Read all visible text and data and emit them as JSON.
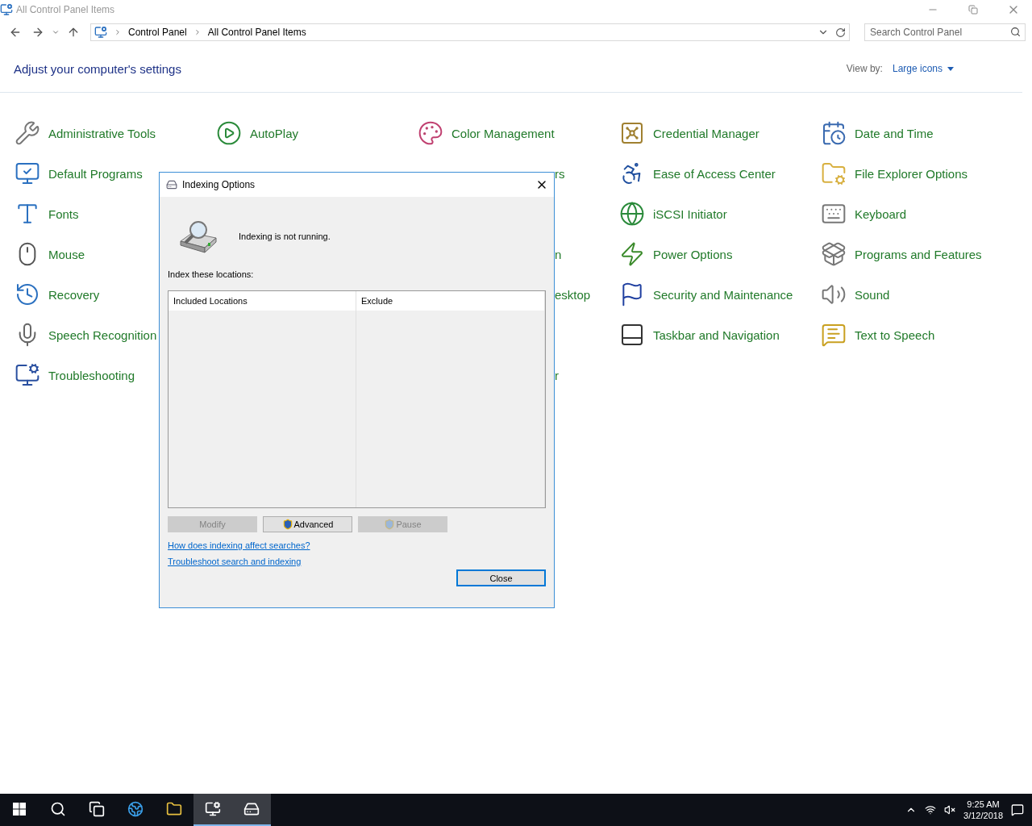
{
  "window": {
    "title": "All Control Panel Items"
  },
  "address_bar": {
    "breadcrumbs": [
      "Control Panel",
      "All Control Panel Items"
    ]
  },
  "search": {
    "placeholder": "Search Control Panel"
  },
  "heading": "Adjust your computer's settings",
  "view_by": {
    "label": "View by:",
    "value": "Large icons"
  },
  "rows": [
    [
      {
        "kind": "item",
        "label": "Administrative Tools"
      },
      {
        "kind": "item",
        "label": "AutoPlay"
      },
      {
        "kind": "item",
        "label": "Color Management"
      },
      {
        "kind": "item",
        "label": "Credential Manager"
      },
      {
        "kind": "item",
        "label": "Date and Time"
      }
    ],
    [
      {
        "kind": "item",
        "label": "Default Programs"
      },
      {
        "kind": "covered"
      },
      {
        "kind": "fragment",
        "label": "rs"
      },
      {
        "kind": "item",
        "label": "Ease of Access Center"
      },
      {
        "kind": "item",
        "label": "File Explorer Options"
      }
    ],
    [
      {
        "kind": "item",
        "label": "Fonts"
      },
      {
        "kind": "covered"
      },
      {
        "kind": "covered"
      },
      {
        "kind": "item",
        "label": "iSCSI Initiator"
      },
      {
        "kind": "item",
        "label": "Keyboard"
      }
    ],
    [
      {
        "kind": "item",
        "label": "Mouse"
      },
      {
        "kind": "covered"
      },
      {
        "kind": "fragment",
        "label": "n"
      },
      {
        "kind": "item",
        "label": "Power Options"
      },
      {
        "kind": "item",
        "label": "Programs and Features"
      }
    ],
    [
      {
        "kind": "item",
        "label": "Recovery"
      },
      {
        "kind": "covered"
      },
      {
        "kind": "fragment",
        "label": "esktop"
      },
      {
        "kind": "item",
        "label": "Security and Maintenance"
      },
      {
        "kind": "item",
        "label": "Sound"
      }
    ],
    [
      {
        "kind": "item",
        "label": "Speech Recognition"
      },
      {
        "kind": "covered"
      },
      {
        "kind": "covered"
      },
      {
        "kind": "item",
        "label": "Taskbar and Navigation"
      },
      {
        "kind": "item",
        "label": "Text to Speech"
      }
    ],
    [
      {
        "kind": "item",
        "label": "Troubleshooting"
      },
      {
        "kind": "covered"
      },
      {
        "kind": "fragment",
        "label": "r"
      }
    ]
  ],
  "dialog": {
    "title": "Indexing Options",
    "status": "Indexing is not running.",
    "list_label": "Index these locations:",
    "columns": [
      "Included Locations",
      "Exclude"
    ],
    "buttons": [
      {
        "label": "Modify",
        "disabled": true,
        "shield": false
      },
      {
        "label": "Advanced",
        "disabled": false,
        "shield": true
      },
      {
        "label": "Pause",
        "disabled": true,
        "shield": true
      }
    ],
    "links": [
      "How does indexing affect searches?",
      "Troubleshoot search and indexing"
    ],
    "close_button": "Close"
  },
  "taskbar": {
    "apps": [
      {
        "kind": "start",
        "selected": false
      },
      {
        "kind": "search",
        "selected": false
      },
      {
        "kind": "taskview",
        "selected": false
      },
      {
        "kind": "browser",
        "selected": false
      },
      {
        "kind": "folder",
        "selected": false
      },
      {
        "kind": "controlpanel",
        "selected": true
      },
      {
        "kind": "indexing",
        "selected": true
      }
    ],
    "time": "9:25 AM",
    "date": "3/12/2018"
  }
}
